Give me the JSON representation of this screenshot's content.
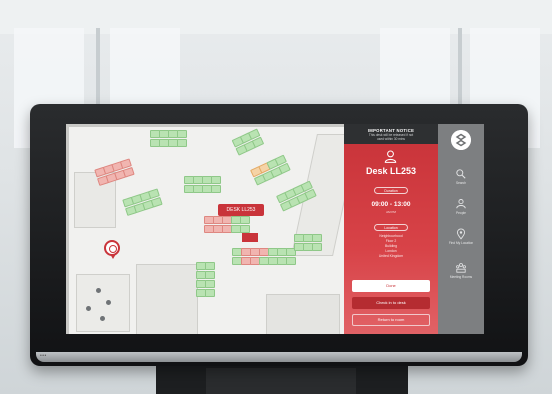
{
  "desk_popup": {
    "label": "DESK LL253"
  },
  "notice": {
    "title": "IMPORTANT NOTICE",
    "line1": "This desk will be released if not",
    "line2": "used within 30 mins"
  },
  "booking": {
    "desk_title": "Desk LL253",
    "duration_label": "Duration",
    "time_range": "09:00 - 13:00",
    "time_sub": "AM      PM",
    "location_label": "Location",
    "location_lines": [
      "Neighbourhood",
      "Floor 2",
      "Building",
      "London",
      "United Kingdom"
    ]
  },
  "actions": {
    "primary": "Done",
    "secondary": "Check in to desk",
    "tertiary": "Return to room"
  },
  "nav": {
    "items": [
      {
        "label": "Search",
        "icon": "search-icon"
      },
      {
        "label": "People",
        "icon": "people-icon"
      },
      {
        "label": "Find My Location",
        "icon": "location-pin-icon"
      },
      {
        "label": "Meeting Rooms",
        "icon": "meeting-room-icon"
      }
    ]
  },
  "colors": {
    "accent": "#c9343a",
    "nav": "#7d7f81",
    "notice": "#2e3032"
  }
}
